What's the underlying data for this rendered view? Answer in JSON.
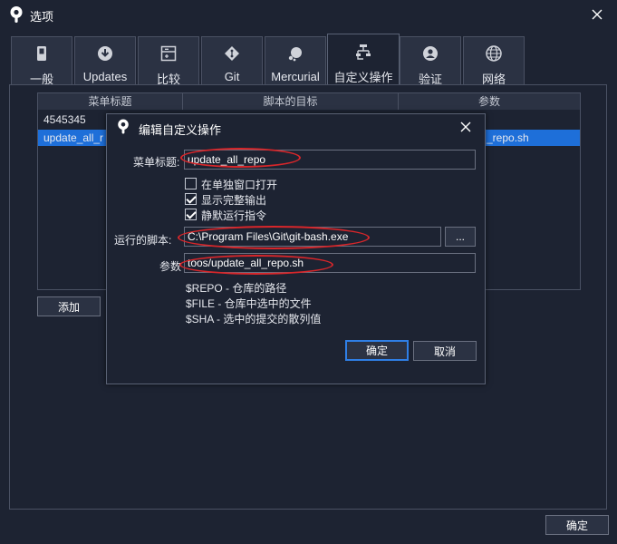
{
  "window": {
    "title": "选项",
    "close_icon": "close-icon"
  },
  "tabs": [
    {
      "label": "一般",
      "icon": "toggle-switch-icon"
    },
    {
      "label": "Updates",
      "icon": "download-icon"
    },
    {
      "label": "比较",
      "icon": "diff-compare-icon"
    },
    {
      "label": "Git",
      "icon": "git-icon"
    },
    {
      "label": "Mercurial",
      "icon": "mercurial-icon"
    },
    {
      "label": "自定义操作",
      "icon": "custom-actions-icon"
    },
    {
      "label": "验证",
      "icon": "user-account-icon"
    },
    {
      "label": "网络",
      "icon": "globe-icon"
    }
  ],
  "active_tab": "自定义操作",
  "actions_table": {
    "headers": [
      "菜单标题",
      "脚本的目标",
      "参数"
    ],
    "rows": [
      {
        "title": "4545345",
        "target": "",
        "params": ""
      },
      {
        "title": "update_all_r",
        "target": "",
        "params": "_repo.sh"
      }
    ],
    "selected_row": 1
  },
  "add_button": "添加",
  "ok_button": "确定",
  "dialog": {
    "title": "编辑自定义操作",
    "menu_title_label": "菜单标题:",
    "menu_title_value": "update_all_repo",
    "checkboxes": [
      {
        "label": "在单独窗口打开",
        "checked": false
      },
      {
        "label": "显示完整输出",
        "checked": true
      },
      {
        "label": "静默运行指令",
        "checked": true
      }
    ],
    "script_label": "运行的脚本:",
    "script_value": "C:\\Program Files\\Git\\git-bash.exe",
    "browse_button": "...",
    "params_label": "参数",
    "params_value": "toos/update_all_repo.sh",
    "hints": [
      "$REPO - 仓库的路径",
      "$FILE - 仓库中选中的文件",
      "$SHA - 选中的提交的散列值"
    ],
    "ok_button": "确定",
    "cancel_button": "取消"
  },
  "colors": {
    "background": "#1d2332",
    "tab_bg": "#2b3243",
    "selection": "#1e6fd9",
    "primary_border": "#2f7fe6",
    "annotation": "#d8262a"
  }
}
